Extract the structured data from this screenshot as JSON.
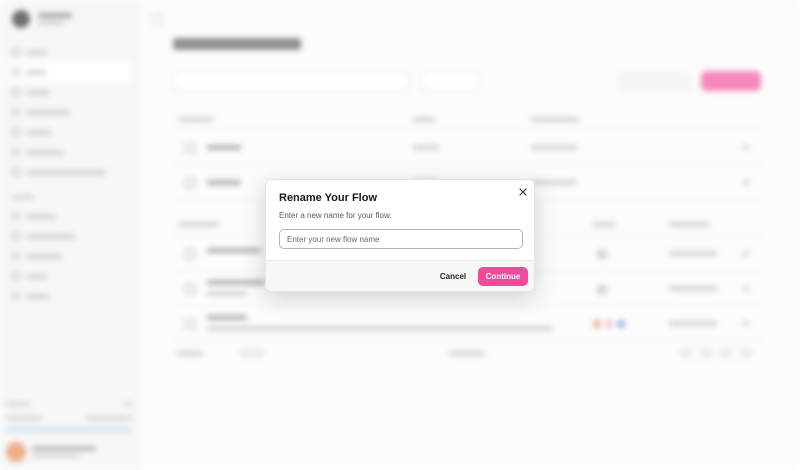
{
  "dialog": {
    "title": "Rename Your Flow",
    "description": "Enter a new name for your flow.",
    "close_icon": "close-icon",
    "input_placeholder": "Enter your new flow name",
    "input_value": "",
    "cancel_label": "Cancel",
    "continue_label": "Continue"
  },
  "colors": {
    "accent": "#f04a9a",
    "overlay": "#ffffff"
  }
}
